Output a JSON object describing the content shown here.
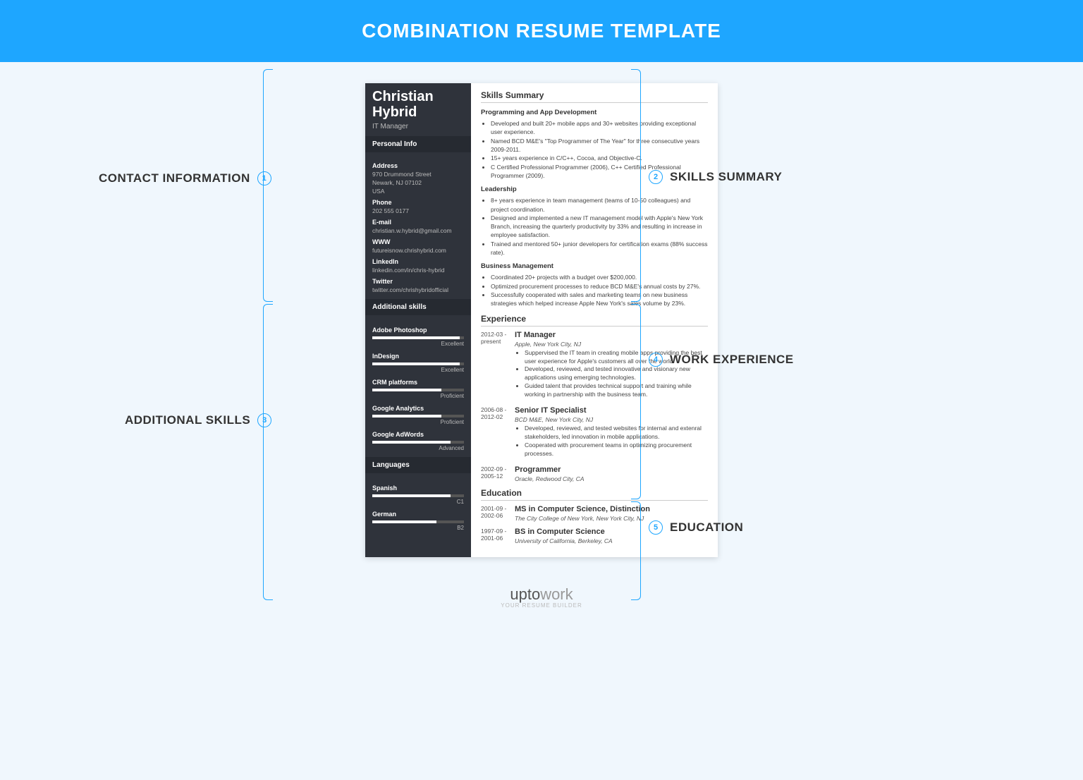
{
  "header": {
    "title": "COMBINATION RESUME TEMPLATE"
  },
  "callouts": {
    "c1": {
      "num": "1",
      "label": "CONTACT INFORMATION"
    },
    "c2": {
      "num": "2",
      "label": "SKILLS SUMMARY"
    },
    "c3": {
      "num": "3",
      "label": "ADDITIONAL SKILLS"
    },
    "c4": {
      "num": "4",
      "label": "WORK EXPERIENCE"
    },
    "c5": {
      "num": "5",
      "label": "EDUCATION"
    }
  },
  "sidebar": {
    "name_first": "Christian",
    "name_last": "Hybrid",
    "role": "IT Manager",
    "info_head": "Personal Info",
    "address_label": "Address",
    "address_l1": "970 Drummond Street",
    "address_l2": "Newark, NJ 07102",
    "address_l3": "USA",
    "phone_label": "Phone",
    "phone": "202 555 0177",
    "email_label": "E-mail",
    "email": "christian.w.hybrid@gmail.com",
    "www_label": "WWW",
    "www": "futureisnow.chrishybrid.com",
    "linkedin_label": "LinkedIn",
    "linkedin": "linkedin.com/in/chris-hybrid",
    "twitter_label": "Twitter",
    "twitter": "twitter.com/chrishybridofficial",
    "skills_head": "Additional skills",
    "skills": [
      {
        "name": "Adobe Photoshop",
        "level": "Excellent",
        "pct": 95
      },
      {
        "name": "InDesign",
        "level": "Excellent",
        "pct": 95
      },
      {
        "name": "CRM platforms",
        "level": "Proficient",
        "pct": 75
      },
      {
        "name": "Google Analytics",
        "level": "Proficient",
        "pct": 75
      },
      {
        "name": "Google AdWords",
        "level": "Advanced",
        "pct": 85
      }
    ],
    "lang_head": "Languages",
    "langs": [
      {
        "name": "Spanish",
        "level": "C1",
        "pct": 85
      },
      {
        "name": "German",
        "level": "B2",
        "pct": 70
      }
    ]
  },
  "main": {
    "skills_head": "Skills Summary",
    "groups": [
      {
        "title": "Programming and App Development",
        "items": [
          "Developed and built 20+ mobile apps and 30+ websites providing exceptional user experience.",
          "Named BCD M&E's \"Top Programmer of The Year\" for three consecutive years 2009-2011.",
          "15+ years experience in C/C++, Cocoa, and Objective-C.",
          "C Certified Professional Programmer (2006), C++ Certified Professional Programmer (2009)."
        ]
      },
      {
        "title": "Leadership",
        "items": [
          "8+ years experience in team management (teams of 10-50 colleagues) and project coordination.",
          "Designed and implemented a new IT management model with Apple's New York Branch, increasing the quarterly productivity by 33% and resulting in increase in employee satisfaction.",
          "Trained and mentored 50+ junior developers for certification exams (88% success rate)."
        ]
      },
      {
        "title": "Business Management",
        "items": [
          "Coordinated 20+ projects with a budget over $200,000.",
          "Optimized procurement processes to reduce BCD M&E's annual costs by 27%.",
          "Successfully cooperated with sales and marketing teams on new business strategies which helped increase Apple New York's sales volume by 23%."
        ]
      }
    ],
    "exp_head": "Experience",
    "jobs": [
      {
        "date": "2012-03 - present",
        "title": "IT Manager",
        "org": "Apple, New York City, NJ",
        "items": [
          "Suppervised the IT team in creating mobile apps providing the best user experience for Apple's customers all over the world.",
          "Developed, reviewed, and tested innovative and visionary new applications using emerging technologies.",
          "Guided talent that provides technical support and training while working in partnership with the business team."
        ]
      },
      {
        "date": "2006-08 - 2012-02",
        "title": "Senior IT Specialist",
        "org": "BCD M&E, New York City, NJ",
        "items": [
          "Developed, reviewed, and tested websites for internal and extenral stakeholders, led innovation in mobile applications.",
          "Cooperated with procurement teams in optimizing procurement processes."
        ]
      },
      {
        "date": "2002-09 - 2005-12",
        "title": "Programmer",
        "org": "Oracle, Redwood City, CA",
        "items": []
      }
    ],
    "edu_head": "Education",
    "edu": [
      {
        "date": "2001-09 - 2002-06",
        "title": "MS in Computer Science, Distinction",
        "org": "The City College of New York, New York City, NJ"
      },
      {
        "date": "1997-09 - 2001-06",
        "title": "BS in Computer Science",
        "org": "University of California, Berkeley, CA"
      }
    ]
  },
  "footer": {
    "brand_a": "upto",
    "brand_b": "work",
    "tag": "YOUR RESUME BUILDER"
  }
}
